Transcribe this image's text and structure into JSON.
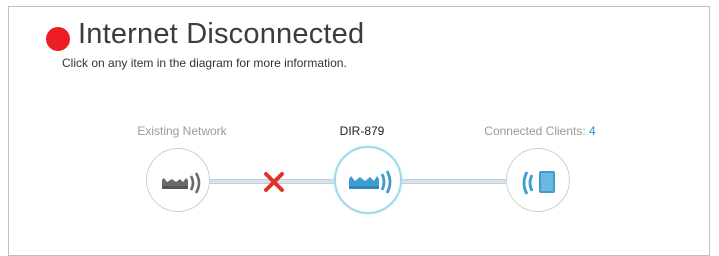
{
  "status": {
    "title": "Internet Disconnected",
    "hint": "Click on any item in the diagram for more information.",
    "dot_color": "#ee1c25"
  },
  "diagram": {
    "existing_network_label": "Existing Network",
    "router_label": "DIR-879",
    "clients_label": "Connected Clients: ",
    "clients_count": "4",
    "disconnect_icon": "red-x-icon",
    "disconnect_color": "#e0332a",
    "accent_color": "#2f8fc9",
    "icons": {
      "existing_network": "router-wifi-icon",
      "router": "router-wifi-icon",
      "clients": "tablet-wifi-icon"
    }
  }
}
